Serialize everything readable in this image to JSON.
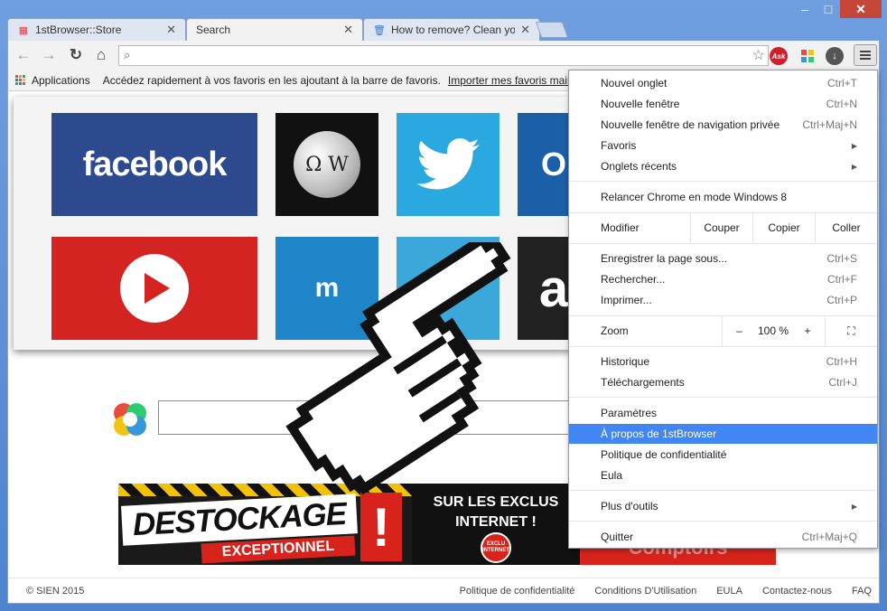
{
  "window": {
    "controls": {
      "minimize": "–",
      "maximize": "□",
      "close": "✕"
    }
  },
  "tabs": [
    {
      "label": "1stBrowser::Store",
      "icon": "store-grid-icon"
    },
    {
      "label": "Search",
      "icon": ""
    },
    {
      "label": "How to remove? Clean yo",
      "icon": "trash-can-icon"
    }
  ],
  "toolbar": {
    "back": "←",
    "forward": "→",
    "reload": "↻",
    "home": "⌂",
    "search_value": "",
    "ext_ask": "Ask"
  },
  "bookmarks": {
    "apps_label": "Applications",
    "hint": "Accédez rapidement à vos favoris en les ajoutant à la barre de favoris.",
    "import_link": "Importer mes favoris maint"
  },
  "tiles": {
    "facebook": "facebook",
    "wikipedia_glyph": "Ω W",
    "twitter_glyph": "🐦",
    "outlook": "O",
    "msn": "m",
    "mail_glyph": "✉",
    "amazon": "a"
  },
  "banner": {
    "destockage": "DESTOCKAGE",
    "exceptionnel": "EXCEPTIONNEL",
    "exclamation": "!",
    "exclu_line1": "SUR LES EXCLUS",
    "exclu_line2": "INTERNET !",
    "badge": "EXCLU INTERNET",
    "right": "Comptoirs"
  },
  "footer": {
    "copyright": "© SIEN 2015",
    "links": [
      "Politique de confidentialité",
      "Conditions D'Utilisation",
      "EULA",
      "Contactez-nous",
      "FAQ"
    ]
  },
  "menu": {
    "items": [
      {
        "label": "Nouvel onglet",
        "shortcut": "Ctrl+T"
      },
      {
        "label": "Nouvelle fenêtre",
        "shortcut": "Ctrl+N"
      },
      {
        "label": "Nouvelle fenêtre de navigation privée",
        "shortcut": "Ctrl+Maj+N"
      },
      {
        "label": "Favoris",
        "shortcut": ""
      },
      {
        "label": "Onglets récents",
        "shortcut": ""
      },
      {
        "label": "Relancer Chrome en mode Windows 8",
        "shortcut": ""
      },
      {
        "label": "Enregistrer la page sous...",
        "shortcut": "Ctrl+S"
      },
      {
        "label": "Rechercher...",
        "shortcut": "Ctrl+F"
      },
      {
        "label": "Imprimer...",
        "shortcut": "Ctrl+P"
      },
      {
        "label": "Historique",
        "shortcut": "Ctrl+H"
      },
      {
        "label": "Téléchargements",
        "shortcut": "Ctrl+J"
      },
      {
        "label": "Paramètres",
        "shortcut": ""
      },
      {
        "label": "À propos de 1stBrowser",
        "shortcut": ""
      },
      {
        "label": "Politique de confidentialité",
        "shortcut": ""
      },
      {
        "label": "Eula",
        "shortcut": ""
      },
      {
        "label": "Plus d'outils",
        "shortcut": ""
      },
      {
        "label": "Quitter",
        "shortcut": "Ctrl+Maj+Q"
      }
    ],
    "edit": {
      "label": "Modifier",
      "cut": "Couper",
      "copy": "Copier",
      "paste": "Coller"
    },
    "zoom": {
      "label": "Zoom",
      "minus": "–",
      "value": "100 %",
      "plus": "+",
      "fullscreen": "⛶"
    },
    "submenu_arrow": "▶",
    "highlight_color": "#4285f4"
  }
}
